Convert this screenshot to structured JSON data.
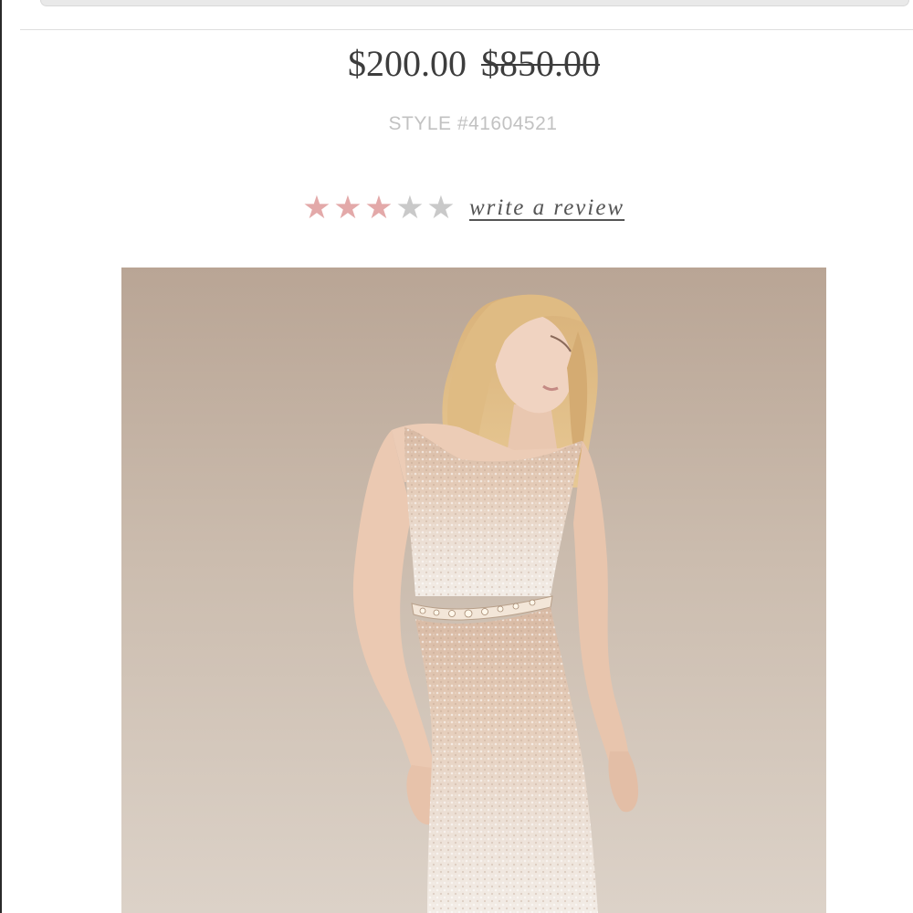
{
  "product": {
    "sale_price": "$200.00",
    "original_price": "$850.00",
    "style_number": "STYLE #41604521",
    "rating": {
      "value": 3,
      "max": 5,
      "filled_color": "#e3a9a9",
      "empty_color": "#c9c9c9"
    },
    "review_link_label": "write a review",
    "photo": {
      "icon": "product-photo-model-sequin-gown"
    }
  }
}
